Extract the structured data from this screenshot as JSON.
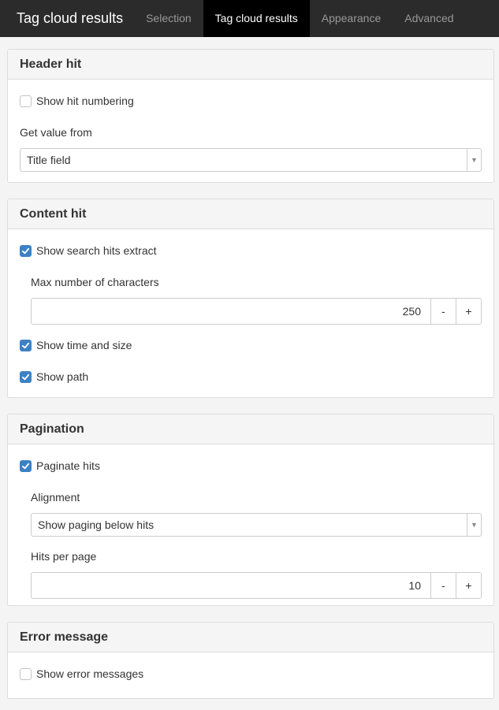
{
  "header": {
    "title": "Tag cloud results",
    "tabs": [
      {
        "label": "Selection"
      },
      {
        "label": "Tag cloud results"
      },
      {
        "label": "Appearance"
      },
      {
        "label": "Advanced"
      }
    ]
  },
  "header_hit": {
    "title": "Header hit",
    "show_numbering": {
      "label": "Show hit numbering",
      "checked": false
    },
    "value_from_label": "Get value from",
    "value_from_selected": "Title field"
  },
  "content_hit": {
    "title": "Content hit",
    "show_extract": {
      "label": "Show search hits extract",
      "checked": true
    },
    "max_chars_label": "Max number of characters",
    "max_chars_value": "250",
    "minus": "-",
    "plus": "+",
    "show_time_size": {
      "label": "Show time and size",
      "checked": true
    },
    "show_path": {
      "label": "Show path",
      "checked": true
    }
  },
  "pagination": {
    "title": "Pagination",
    "paginate": {
      "label": "Paginate hits",
      "checked": true
    },
    "alignment_label": "Alignment",
    "alignment_selected": "Show paging below hits",
    "hits_per_page_label": "Hits per page",
    "hits_per_page_value": "10",
    "minus": "-",
    "plus": "+"
  },
  "error_message": {
    "title": "Error message",
    "show_errors": {
      "label": "Show error messages",
      "checked": false
    }
  },
  "colors": {
    "topbar": "#2b2b2b",
    "active_tab": "#000000",
    "checkbox_checked": "#3b82c4"
  },
  "icons": {
    "checkmark": "check-icon",
    "select_arrow": "caret-down-icon"
  }
}
